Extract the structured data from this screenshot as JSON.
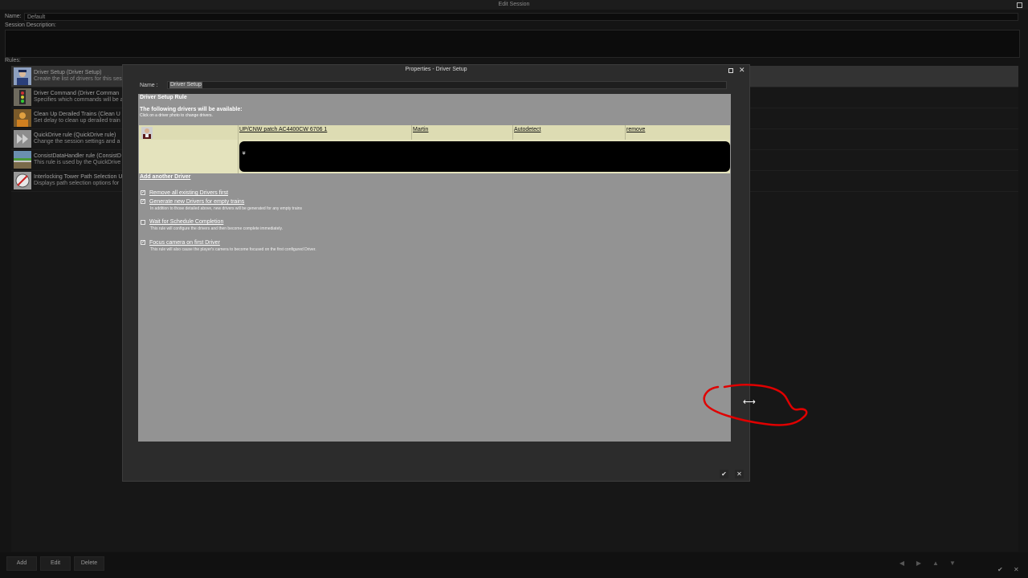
{
  "window": {
    "title": "Edit Session"
  },
  "session": {
    "name_label": "Name:",
    "name_value": "Default",
    "desc_label": "Session Description:",
    "rules_label": "Rules:"
  },
  "rules": [
    {
      "title": "Driver Setup  (Driver Setup)",
      "desc": "Create the list of drivers for this ses",
      "icon": "driver-portrait-icon"
    },
    {
      "title": "Driver Command  (Driver Comman",
      "desc": "Specifies which commands will be a",
      "icon": "signal-light-icon"
    },
    {
      "title": "Clean Up Derailed Trains  (Clean U",
      "desc": "Set delay to clean up derailed train",
      "icon": "worker-icon"
    },
    {
      "title": "QuickDrive rule  (QuickDrive rule)",
      "desc": "Change the session settings and a",
      "icon": "fast-forward-icon"
    },
    {
      "title": "ConsistDataHandler rule  (ConsistD",
      "desc": "This rule is used by the QuickDrive",
      "icon": "terrain-icon"
    },
    {
      "title": "Interlocking Tower Path Selection U",
      "desc": "Displays path selection options for",
      "icon": "compass-icon"
    }
  ],
  "bottom_buttons": {
    "add": "Add",
    "edit": "Edit",
    "delete": "Delete"
  },
  "dialog": {
    "title": "Properties - Driver Setup",
    "name_label": "Name :",
    "name_value": "Driver Setup",
    "heading": "Driver Setup Rule",
    "available_heading": "The following drivers will be available:",
    "click_hint": "Click on a driver photo to change drivers.",
    "driver_row": {
      "train": "UP/CNW patch AC4400CW 6706 1",
      "driver": "Martin",
      "mode": "Autodetect",
      "remove": "remove"
    },
    "expand_glyph": "»",
    "add_driver": "Add another Driver",
    "options": [
      {
        "label": "Remove all existing Drivers first",
        "desc": "",
        "checked": true
      },
      {
        "label": "Generate new Drivers for empty trains",
        "desc": "In addition to those detailed above, new drivers will be generated for any empty trains",
        "checked": true
      },
      {
        "label": "Wait for Schedule Completion",
        "desc": "This rule will configure the drivers and then become complete immediately.",
        "checked": false
      },
      {
        "label": "Focus camera on first Driver",
        "desc": "This rule will also cause the player's camera to become focused on the first configured Driver.",
        "checked": true
      }
    ],
    "ok_glyph": "✔",
    "cancel_glyph": "✕"
  },
  "colors": {
    "annotation": "#e00000",
    "panel": "#939393",
    "driver_row": "#dddcb3"
  }
}
